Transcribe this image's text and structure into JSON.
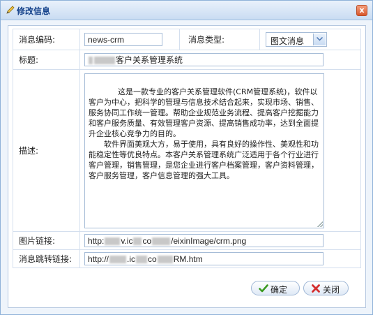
{
  "window": {
    "title": "修改信息",
    "close_glyph": "x"
  },
  "form": {
    "code_label": "消息编码:",
    "code_value": "news-crm",
    "type_label": "消息类型:",
    "type_value": "图文消息",
    "title_label": "标题:",
    "title_value": "客户关系管理系统",
    "desc_label": "描述:",
    "desc_value": "这是一款专业的客户关系管理软件(CRM管理系统)，软件以客户为中心，把科学的管理与信息技术结合起来，实现市场、销售、服务协同工作统一管理。帮助企业规范业务流程、提高客户挖掘能力和客户服务质量、有效管理客户资源、提高销售成功率，达到全面提升企业核心竞争力的目的。\n　　软件界面美观大方，易于使用，具有良好的操作性、美观性和功能稳定性等优良特点。本客户关系管理系统广泛适用于各个行业进行客户管理，销售管理，是您企业进行客户档案管理，客户资料管理，客户服务管理，客户信息管理的强大工具。",
    "pic_label": "图片链接:",
    "pic_value_start": "http:",
    "pic_value_mid1": "v.ic",
    "pic_value_mid2": "co",
    "pic_value_end": "/eixinImage/crm.png",
    "jump_label": "消息跳转链接:",
    "jump_value_start": "http://",
    "jump_value_mid": ".ic",
    "jump_value_mid2": "co",
    "jump_value_end": "RM.htm"
  },
  "buttons": {
    "ok_label": "确定",
    "close_label": "关闭"
  },
  "icons": [
    "pencil-icon",
    "close-icon",
    "chevron-down-icon",
    "check-icon",
    "cross-icon"
  ],
  "colors": {
    "title_text": "#15428b",
    "close_button": "#d8562b",
    "ok_icon": "#3a9a1f",
    "cancel_icon": "#d42f2f"
  }
}
